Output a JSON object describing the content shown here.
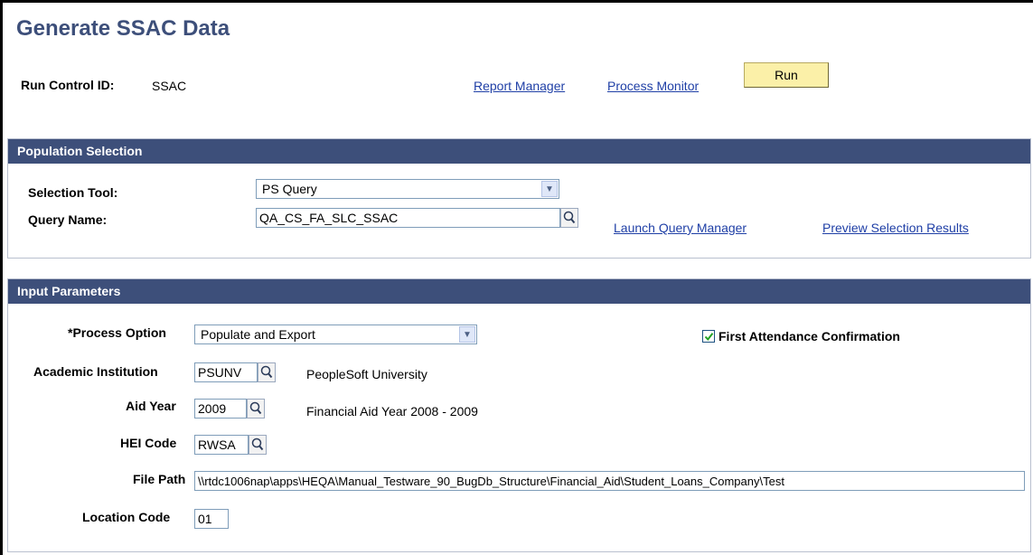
{
  "page": {
    "title": "Generate SSAC Data"
  },
  "run_control": {
    "label": "Run Control ID:",
    "value": "SSAC"
  },
  "links": {
    "report_manager": "Report Manager",
    "process_monitor": "Process Monitor"
  },
  "run_button": {
    "label": "Run"
  },
  "population_selection": {
    "header": "Population Selection",
    "selection_tool": {
      "label": "Selection Tool:",
      "value": "PS Query"
    },
    "query_name": {
      "label": "Query Name:",
      "value": "QA_CS_FA_SLC_SSAC"
    },
    "launch_query_manager": "Launch Query Manager",
    "preview_selection_results": "Preview Selection Results"
  },
  "input_parameters": {
    "header": "Input Parameters",
    "process_option": {
      "label": "*Process Option",
      "value": "Populate and Export"
    },
    "first_attendance": {
      "label": "First Attendance Confirmation",
      "checked": true
    },
    "academic_institution": {
      "label": "Academic Institution",
      "value": "PSUNV",
      "description": "PeopleSoft University"
    },
    "aid_year": {
      "label": "Aid Year",
      "value": "2009",
      "description": "Financial Aid Year 2008 - 2009"
    },
    "hei_code": {
      "label": "HEI Code",
      "value": "RWSA"
    },
    "file_path": {
      "label": "File Path",
      "value": "\\\\rtdc1006nap\\apps\\HEQA\\Manual_Testware_90_BugDb_Structure\\Financial_Aid\\Student_Loans_Company\\Test"
    },
    "location_code": {
      "label": "Location Code",
      "value": "01"
    }
  },
  "colors": {
    "header_bg": "#3d4f7a",
    "link": "#1f3fa6",
    "run_button_bg": "#fbf0a8"
  },
  "icons": {
    "lookup": "magnifier-lookup-icon",
    "dropdown": "chevron-down-icon",
    "checkbox": "checkmark-icon"
  }
}
